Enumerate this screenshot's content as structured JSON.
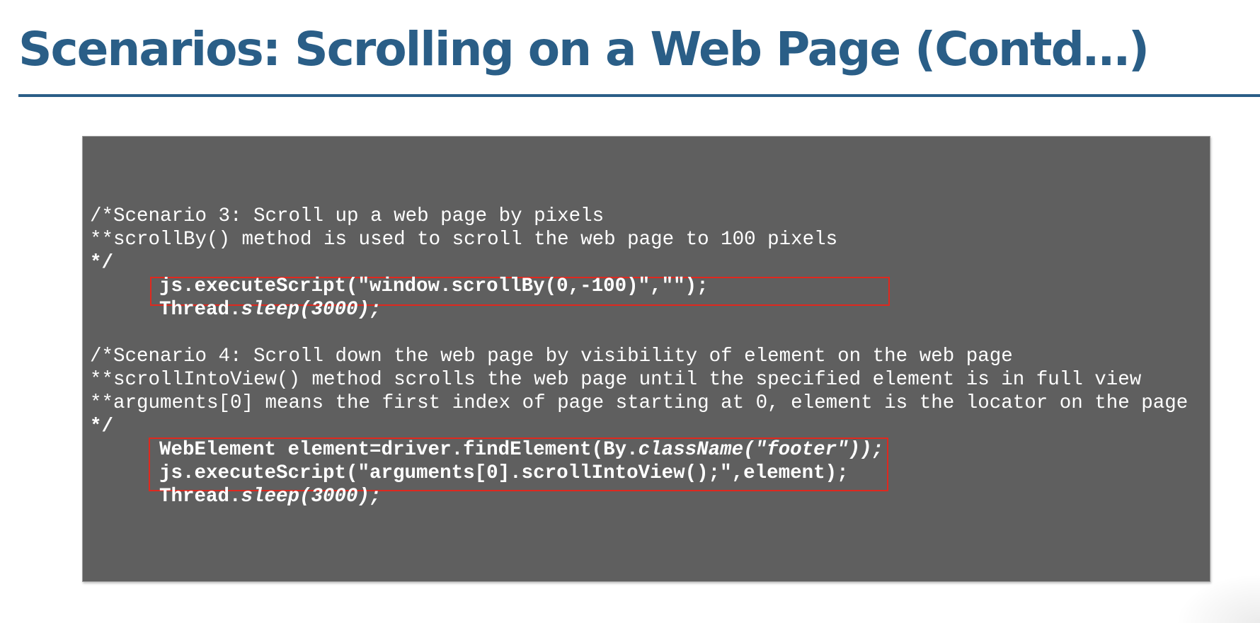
{
  "slide": {
    "title": "Scenarios: Scrolling on a Web Page (Contd…)"
  },
  "code": {
    "scenario3": {
      "comment_line1": "/*Scenario 3: Scroll up a web page by pixels",
      "comment_line2": "**scrollBy() method is used to scroll the web page to 100 pixels",
      "comment_end": "*/",
      "stmt_execute": "js.executeScript(\"window.scrollBy(0,-100)\",\"\");",
      "stmt_sleep_prefix": "Thread.",
      "stmt_sleep_call": "sleep(3000);"
    },
    "scenario4": {
      "comment_line1": "/*Scenario 4: Scroll down the web page by visibility of element on the web page",
      "comment_line2": "**scrollIntoView() method scrolls the web page until the specified element is in full view",
      "comment_line3": "**arguments[0] means the first index of page starting at 0, element is the locator on the page",
      "comment_end": "*/",
      "stmt_find_prefix": "WebElement element=driver.findElement(By.",
      "stmt_find_call": "className(\"footer\"));",
      "stmt_execute": "js.executeScript(\"arguments[0].scrollIntoView();\",element);",
      "stmt_sleep_prefix": "Thread.",
      "stmt_sleep_call": "sleep(3000);"
    }
  },
  "colors": {
    "title": "#2a5e87",
    "panel_background": "#5f5f5f",
    "code_text": "#ffffff",
    "highlight_border": "#e0281e"
  }
}
